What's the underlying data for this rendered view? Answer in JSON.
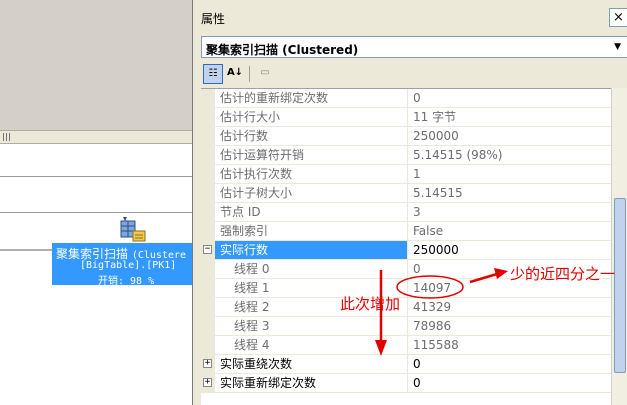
{
  "plan": {
    "operator": {
      "title": "聚集索引扫描",
      "subtitle": "(Clustere",
      "table": "[BigTable].[PK1]",
      "cost": "开销: 98 %"
    }
  },
  "properties": {
    "window_title": "属性",
    "close_glyph": "×",
    "object_label": "聚集索引扫描 (Clustered)",
    "dropdown_glyph": "▼",
    "toolbar": {
      "categorized_glyph": "☷",
      "alphabetical_glyph": "A↓",
      "pages_glyph": "▭"
    },
    "rows": [
      {
        "name": "估计的重新绑定次数",
        "value": "0"
      },
      {
        "name": "估计行大小",
        "value": "11 字节"
      },
      {
        "name": "估计行数",
        "value": "250000"
      },
      {
        "name": "估计运算符开销",
        "value": "5.14515 (98%)"
      },
      {
        "name": "估计执行次数",
        "value": "1"
      },
      {
        "name": "估计子树大小",
        "value": "5.14515"
      },
      {
        "name": "节点 ID",
        "value": "3"
      },
      {
        "name": "强制索引",
        "value": "False"
      },
      {
        "name": "实际行数",
        "value": "250000",
        "expander": "−"
      },
      {
        "name": "线程 0",
        "value": "0"
      },
      {
        "name": "线程 1",
        "value": "14097"
      },
      {
        "name": "线程 2",
        "value": "41329"
      },
      {
        "name": "线程 3",
        "value": "78986"
      },
      {
        "name": "线程 4",
        "value": "115588"
      },
      {
        "name": "实际重绕次数",
        "value": "0",
        "expander": "+"
      },
      {
        "name": "实际重新绑定次数",
        "value": "0",
        "expander": "+"
      }
    ]
  },
  "annotations": {
    "increase_note": "此次增加",
    "quarter_note": "少的近四分之一"
  },
  "colors": {
    "selection": "#3399ff",
    "annotation": "#e00000"
  }
}
